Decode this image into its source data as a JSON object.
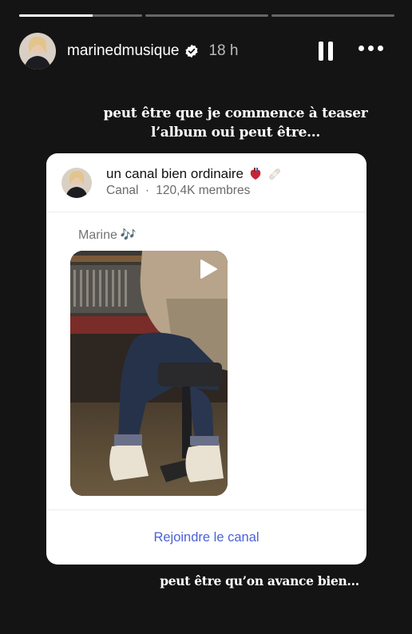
{
  "progress": [
    1,
    0,
    0
  ],
  "story": {
    "username": "marinedmusique",
    "time": "18 h",
    "caption_top": "peut être que je commence à teaser l’album oui peut être...",
    "caption_bottom": "peut être qu’on avance bien..."
  },
  "channel_card": {
    "title": "un canal bien ordinaire",
    "title_emoji": [
      "anatomical-heart-icon",
      "bandage-icon"
    ],
    "type": "Canal",
    "separator": "·",
    "members": "120,4K membres",
    "sender": "Marine",
    "sender_emoji": "🎶",
    "join_label": "Rejoindre le canal"
  },
  "colors": {
    "background": "#141414",
    "card": "#ffffff",
    "link": "#4a62d6",
    "verified": "#ffffff"
  }
}
